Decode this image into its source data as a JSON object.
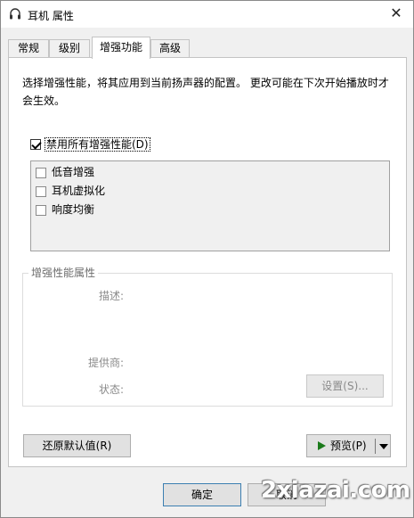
{
  "window": {
    "title": "耳机 属性",
    "close_glyph": "✕"
  },
  "tabs": [
    {
      "label": "常规"
    },
    {
      "label": "级别"
    },
    {
      "label": "增强功能",
      "active": true
    },
    {
      "label": "高级"
    }
  ],
  "enhancements": {
    "description": "选择增强性能，将其应用到当前扬声器的配置。 更改可能在下次开始播放时才会生效。",
    "disable_all": {
      "label": "禁用所有增强性能(D)",
      "checked": true
    },
    "items": [
      {
        "label": "低音增强",
        "checked": false
      },
      {
        "label": "耳机虚拟化",
        "checked": false
      },
      {
        "label": "响度均衡",
        "checked": false
      }
    ]
  },
  "properties": {
    "group_title": "增强性能属性",
    "description_label": "描述:",
    "provider_label": "提供商:",
    "status_label": "状态:",
    "settings_button": "设置(S)..."
  },
  "buttons": {
    "restore_defaults": "还原默认值(R)",
    "preview": "预览(P)",
    "ok": "确定",
    "cancel": "取消"
  },
  "watermark": "2xiazai.com",
  "icons": {
    "title": "headphones-icon",
    "preview": "play-triangle-icon",
    "dropdown": "dropdown-arrow-icon"
  },
  "colors": {
    "window_bg": "#f0f0f0",
    "panel_bg": "#ffffff",
    "default_button_border": "#3c7fb1",
    "preview_icon": "#1a7a1a"
  }
}
